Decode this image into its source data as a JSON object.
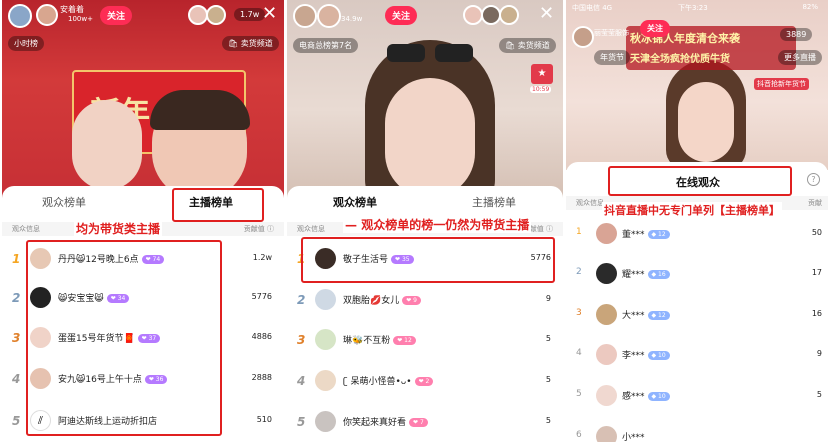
{
  "panel1": {
    "user": "安着着",
    "user_sub": "100w+",
    "follow": "关注",
    "viewers": "1.7w",
    "close": "✕",
    "hour_rank": "小时榜",
    "shop_channel": "卖货频道",
    "banner_text": "新年 意",
    "tab_audience": "观众榜单",
    "tab_anchor": "主播榜单",
    "col_left": "观众信息",
    "col_right": "贡献值 ⓘ",
    "annotation": "均为带货类主播",
    "rows": [
      {
        "rank": "1",
        "name": "丹丹😸12号晚上6点",
        "level": "74",
        "score": "1.2w"
      },
      {
        "rank": "2",
        "name": "😸安宝宝😸",
        "level": "34",
        "score": "5776"
      },
      {
        "rank": "3",
        "name": "蛋蛋15号年货节🧧",
        "level": "37",
        "score": "4886"
      },
      {
        "rank": "4",
        "name": "安九😸16号上午十点",
        "level": "36",
        "score": "2888"
      },
      {
        "rank": "5",
        "name": "阿迪达斯线上运动折扣店",
        "level": "",
        "score": "510"
      }
    ]
  },
  "panel2": {
    "follow": "关注",
    "user_sub": "34.9w",
    "ecom_rank": "电商总榜第7名",
    "shop_channel": "卖货频道",
    "tag": "10:59",
    "tab_audience": "观众榜单",
    "tab_anchor": "主播榜单",
    "col_left": "观众信息",
    "col_right": "贡献值 ⓘ",
    "annotation": "观众榜单的榜一仍然为带货主播",
    "rows": [
      {
        "rank": "1",
        "name": "敬子生活号",
        "level": "35",
        "score": "5776"
      },
      {
        "rank": "2",
        "name": "双胞胎💋女儿",
        "level": "9",
        "score": "9"
      },
      {
        "rank": "3",
        "name": "琳🐝不互粉",
        "level": "12",
        "score": "5"
      },
      {
        "rank": "4",
        "name": "ʗ 呆萌小怪兽•ᴗ•",
        "level": "2",
        "score": "5"
      },
      {
        "rank": "5",
        "name": "你笑起来真好看",
        "level": "7",
        "score": "5"
      }
    ]
  },
  "panel3": {
    "status_carrier": "中国电信 4G",
    "status_time": "下午3:23",
    "status_battery": "82%",
    "user": "丽莹莹服饰",
    "follow": "关注",
    "viewers": "3889",
    "year_goods": "年货节",
    "more_live": "更多直播",
    "banner1": "秋冰锦人年度清仓来袭",
    "banner2": "天津全场疯抢优质牛货",
    "banner3": "抖音抢新年货节",
    "tab_online": "在线观众",
    "col_left": "观众信息",
    "col_right": "贡献",
    "annotation": "抖音直播中无专门单列【主播榜单】",
    "rows": [
      {
        "rank": "1",
        "name": "董***",
        "level": "12",
        "score": "50"
      },
      {
        "rank": "2",
        "name": "耀***",
        "level": "16",
        "score": "17"
      },
      {
        "rank": "3",
        "name": "大***",
        "level": "12",
        "score": "16"
      },
      {
        "rank": "4",
        "name": "李***",
        "level": "10",
        "score": "9"
      },
      {
        "rank": "5",
        "name": "感***",
        "level": "10",
        "score": "5"
      },
      {
        "rank": "6",
        "name": "小***",
        "level": "",
        "score": ""
      }
    ]
  },
  "colors": {
    "accent": "#e02020",
    "follow": "#fe2c55"
  }
}
